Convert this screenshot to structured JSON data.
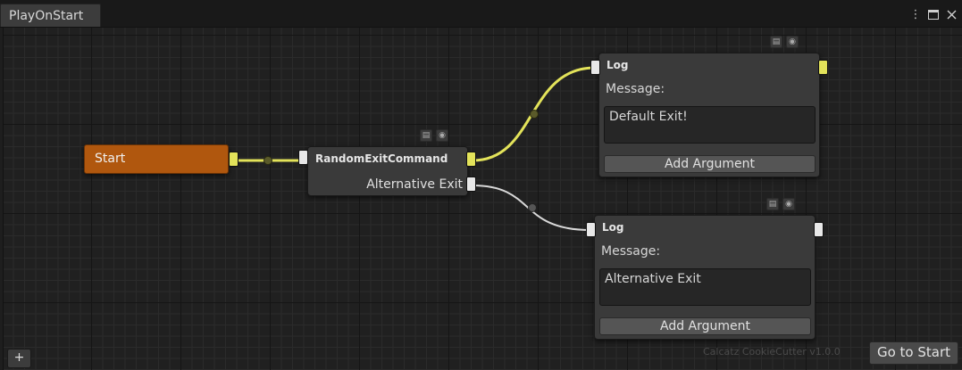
{
  "window": {
    "tab_title": "PlayOnStart",
    "menu_icon": "kebab-menu-icon",
    "maximize_icon": "maximize-icon",
    "close_icon": "close-icon"
  },
  "nodes": {
    "start": {
      "label": "Start"
    },
    "random_exit": {
      "title": "RandomExitCommand",
      "alt_output_label": "Alternative Exit"
    },
    "log_default": {
      "title": "Log",
      "message_label": "Message:",
      "message_value": "Default Exit!",
      "add_argument_label": "Add Argument"
    },
    "log_alternative": {
      "title": "Log",
      "message_label": "Message:",
      "message_value": "Alternative Exit",
      "add_argument_label": "Add Argument"
    }
  },
  "footer": {
    "add_label": "+",
    "version_text": "Calcatz CookieCutter v1.0.0",
    "go_to_start_label": "Go to Start"
  },
  "colors": {
    "start_node": "#b0570e",
    "active_wire": "#e3e35a",
    "inactive_wire": "#d8d8d8"
  }
}
